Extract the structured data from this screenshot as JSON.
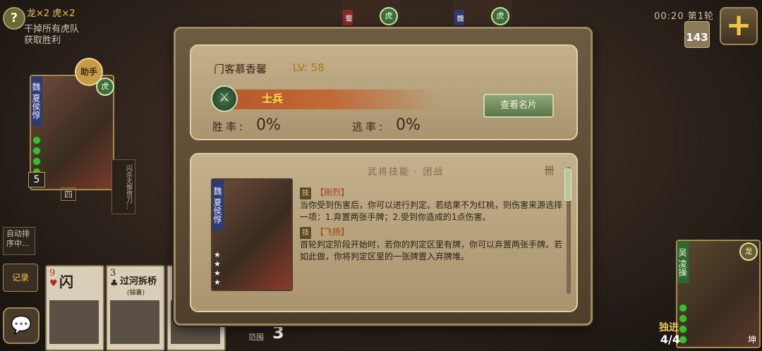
{
  "hud": {
    "help_icon": "?",
    "dragon_label": "龙",
    "dragon_count": "×2",
    "tiger_label": "虎",
    "tiger_count": "×2",
    "objective_line1": "干掉所有虎队",
    "objective_line2": "获取胜利",
    "timer": "00:20 第1轮",
    "plus_icon": "+",
    "deck_count": "143"
  },
  "left_player": {
    "assist_label": "助手",
    "tiger_badge": "虎",
    "kingdom": "魏",
    "name": "夏侯惇",
    "hand_count": "5",
    "seat": "四",
    "flash_note": "闪杀无懈借刀…",
    "auto_sort": "自动排序中...",
    "record_label": "记录"
  },
  "hand_cards": [
    {
      "rank": "9",
      "suit": "♥",
      "name": "闪"
    },
    {
      "rank": "3",
      "suit": "♣",
      "name": "过河拆桥",
      "sub": "(锦囊)"
    }
  ],
  "range": {
    "label": "范围",
    "value": "3"
  },
  "top_players": [
    {
      "kingdom": "蜀",
      "badge": "虎"
    },
    {
      "kingdom": "魏",
      "badge": "虎"
    }
  ],
  "right_player": {
    "kingdom": "吴",
    "name": "凌操",
    "badge": "龙",
    "lone_label": "独进",
    "deck": "4/4",
    "side": "坤"
  },
  "dialog": {
    "player_name": "门客慕香馨",
    "level": "LV: 58",
    "rank_icon": "⚔",
    "rank_title": "士兵",
    "view_card_button": "查看名片",
    "win_rate_label": "胜率:",
    "win_rate_value": "0%",
    "escape_rate_label": "逃率:",
    "escape_rate_value": "0%",
    "skill_section_title": "武将技能 · 团战",
    "scroll_icon": "卌",
    "hero_kingdom": "魏",
    "hero_name": "夏侯惇",
    "hero_stars": 4,
    "skills": [
      {
        "tag": "技",
        "name": "【刚烈】",
        "desc": "当你受到伤害后，你可以进行判定。若结果不为红桃，则伤害来源选择一项：1.弃置两张手牌；2.受到你造成的1点伤害。"
      },
      {
        "tag": "技",
        "name": "【飞扬】",
        "desc": "首轮判定阶段开始时，若你的判定区里有牌，你可以弃置两张手牌。若如此做，你将判定区里的一张牌置入弃牌堆。"
      }
    ]
  }
}
